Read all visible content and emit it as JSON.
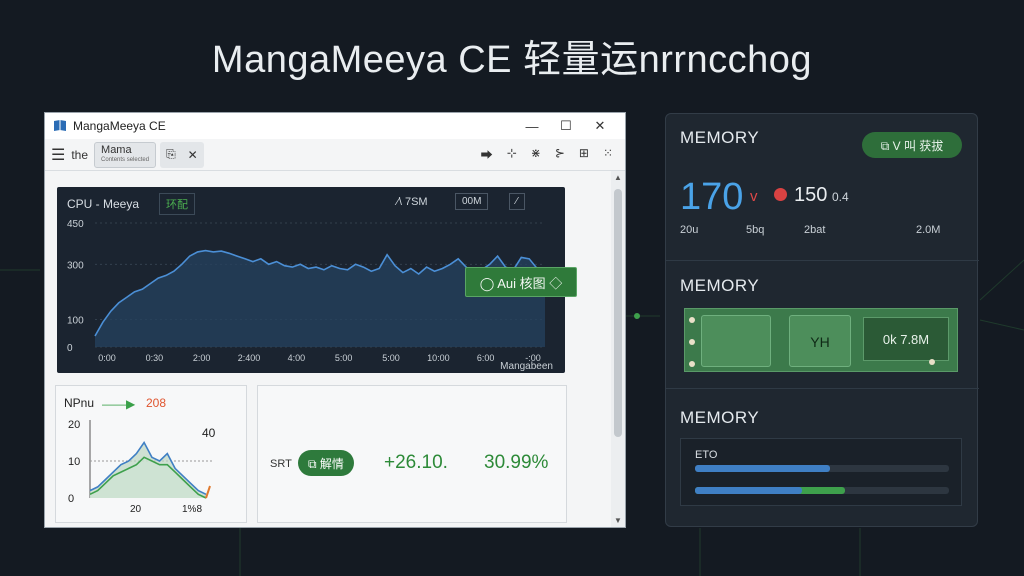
{
  "headline": "MangaMeeya CE  轻量运nrrncchog",
  "window": {
    "title": "MangaMeeya CE",
    "controls": {
      "minimize": "—",
      "maximize": "☐",
      "close": "✕"
    },
    "toolbar": {
      "menu_icon": "☰",
      "the_label": "the",
      "tab_title": "Mama",
      "tab_subtitle": "Contents selected",
      "tab_icon_a": "⎘",
      "tab_close": "✕",
      "icons": [
        "⮕",
        "⊹",
        "⋇",
        "⊱",
        "⊞",
        "⁙"
      ]
    }
  },
  "cpu_chart": {
    "title": "CPU - Meeya",
    "badge": "环配",
    "stat": "⁄\\ 7SM",
    "box1": "00M",
    "box2": "⁄",
    "auto_pill": "◯ Aui 核图 ◇",
    "corner_label": "Mangabeen"
  },
  "chart_data": [
    {
      "type": "area",
      "title": "CPU - Meeya",
      "ylim": [
        0,
        450
      ],
      "y_ticks": [
        "450",
        "300",
        "100",
        "0"
      ],
      "x_ticks": [
        "0:00",
        "0:30",
        "2:00",
        "2:400",
        "4:00",
        "5:00",
        "5:00",
        "10:00",
        "6:00",
        "-:00"
      ],
      "series": [
        {
          "values": [
            40,
            90,
            130,
            160,
            180,
            200,
            210,
            230,
            250,
            260,
            275,
            300,
            330,
            345,
            350,
            345,
            348,
            340,
            330,
            320,
            310,
            320,
            300,
            310,
            295,
            290,
            300,
            285,
            290,
            280,
            295,
            285,
            280,
            300,
            290,
            275,
            285,
            335,
            295,
            270,
            285,
            265,
            290,
            275,
            285,
            300,
            320,
            290,
            265,
            280,
            300,
            330,
            290,
            280,
            325,
            320,
            285,
            275
          ]
        }
      ]
    },
    {
      "type": "area",
      "title": "NPnu",
      "ylim": [
        0,
        20
      ],
      "y_ticks": [
        "20",
        "10",
        "0"
      ],
      "x_ticks": [
        "20",
        "1%8"
      ],
      "series": [
        {
          "values": [
            2,
            3,
            5,
            7,
            9,
            10,
            12,
            15,
            11,
            10,
            12,
            8,
            6,
            4,
            2,
            1
          ]
        },
        {
          "values": [
            1,
            2,
            4,
            6,
            7,
            8,
            9,
            11,
            10,
            9,
            9,
            7,
            5,
            3,
            1,
            0
          ]
        }
      ]
    }
  ],
  "npu": {
    "label": "NPnu",
    "arrow": "——▶",
    "value": "208",
    "right_value": "40"
  },
  "stats": {
    "srt": "SRT",
    "pill": "⧉ 解情",
    "number": "+26.10.",
    "percent": "30.99%"
  },
  "memory": {
    "heading1": "MEMORY",
    "pill": "⧉ V 叫 获拔",
    "big_value": "170",
    "down_mark": "v",
    "second_value": "150",
    "second_unit": "0.4",
    "labels": [
      "20u",
      "5bq",
      "2bat",
      "2.0M"
    ],
    "heading2": "MEMORY",
    "chip_text": "YH",
    "ram_label": "0k 7.8M",
    "heading3": "MEMORY",
    "bar_label": "ETO",
    "bar1_fraction": 0.53,
    "bar2_blue_fraction": 0.42,
    "bar2_green_fraction": 0.59
  },
  "colors": {
    "background": "#141a22",
    "accent_blue": "#4aa3e8",
    "accent_green": "#2e7a3c",
    "alert_red": "#d94242"
  }
}
